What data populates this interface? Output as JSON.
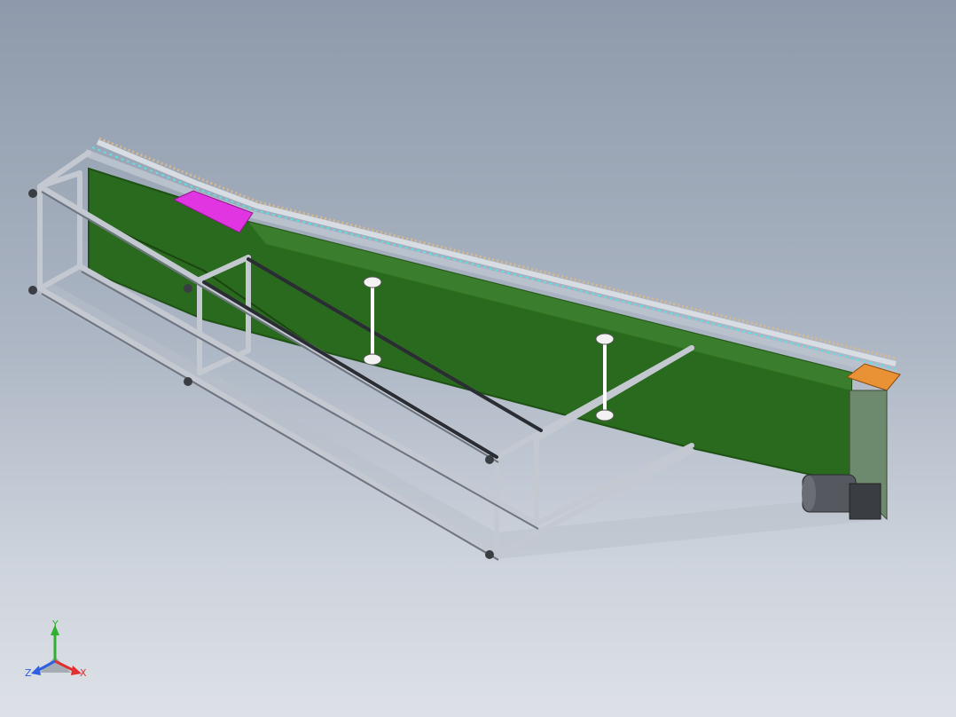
{
  "viewport": {
    "background_top": "#8e9aab",
    "background_bottom": "#dde1e7"
  },
  "model": {
    "panel_color": "#2a6a1e",
    "panel_dark": "#1e5215",
    "frame_color": "#c4c9d1",
    "frame_shadow": "#6e7480",
    "rail_color": "#b9c2cc",
    "roller_color": "#d9b98e",
    "belt_dot_color": "#5fe0e6",
    "magenta_plate": "#e035e0",
    "orange_plate": "#e89235",
    "end_housing": "#6e8a6e",
    "motor_color": "#55595f"
  },
  "triad": {
    "y_label": "Y",
    "x_label": "X",
    "z_label": "Z",
    "x_color": "#e03030",
    "y_color": "#30b030",
    "z_color": "#3060e0"
  }
}
